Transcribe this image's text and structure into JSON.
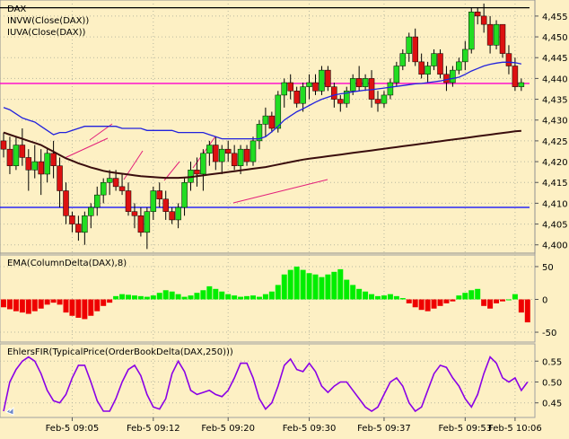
{
  "chart_data": [
    {
      "type": "candlestick",
      "labels": [
        "DAX",
        "INVW(Close(DAX))",
        "IUVA(Close(DAX))"
      ],
      "ylim": [
        4398,
        4458
      ],
      "yticks": [
        "4,400",
        "4,405",
        "4,410",
        "4,415",
        "4,420",
        "4,425",
        "4,430",
        "4,435",
        "4,440",
        "4,445",
        "4,450",
        "4,455"
      ],
      "xticks": [
        "Feb-5 09:05",
        "Feb-5 09:12",
        "Feb-5 09:20",
        "Feb-5 09:30",
        "Feb-5 09:37",
        "Feb-5 09:53",
        "Feb-5 10:06"
      ],
      "reference_lines": [
        {
          "value": 4457,
          "color": "#000000"
        },
        {
          "value": 4438.8,
          "color": "#ff00cc"
        },
        {
          "value": 4409,
          "color": "#0000ff"
        }
      ],
      "candles": [
        [
          4425,
          4427,
          4421,
          4423
        ],
        [
          4423,
          4426,
          4417,
          4419
        ],
        [
          4419,
          4426,
          4418,
          4424
        ],
        [
          4424,
          4428,
          4419,
          4421
        ],
        [
          4421,
          4423,
          4413,
          4418
        ],
        [
          4418,
          4424,
          4416,
          4420
        ],
        [
          4420,
          4423,
          4412,
          4417
        ],
        [
          4417,
          4423,
          4415,
          4422
        ],
        [
          4422,
          4425,
          4416,
          4419
        ],
        [
          4419,
          4421,
          4409,
          4413
        ],
        [
          4413,
          4415,
          4405,
          4407
        ],
        [
          4407,
          4408,
          4403,
          4405
        ],
        [
          4405,
          4407,
          4401,
          4403
        ],
        [
          4403,
          4408,
          4400,
          4407
        ],
        [
          4407,
          4410,
          4404,
          4409
        ],
        [
          4409,
          4414,
          4407,
          4412
        ],
        [
          4412,
          4416,
          4410,
          4415
        ],
        [
          4415,
          4418,
          4412,
          4416
        ],
        [
          4416,
          4418,
          4413,
          4414
        ],
        [
          4414,
          4417,
          4412,
          4413
        ],
        [
          4413,
          4415,
          4407,
          4408
        ],
        [
          4408,
          4410,
          4404,
          4407
        ],
        [
          4407,
          4409,
          4402,
          4403
        ],
        [
          4403,
          4409,
          4399,
          4408
        ],
        [
          4408,
          4414,
          4406,
          4413
        ],
        [
          4413,
          4415,
          4409,
          4411
        ],
        [
          4411,
          4413,
          4406,
          4408
        ],
        [
          4408,
          4409,
          4405,
          4406
        ],
        [
          4406,
          4410,
          4404,
          4409
        ],
        [
          4409,
          4416,
          4407,
          4415
        ],
        [
          4415,
          4420,
          4413,
          4418
        ],
        [
          4418,
          4421,
          4414,
          4417
        ],
        [
          4417,
          4423,
          4413,
          4422
        ],
        [
          4422,
          4425,
          4419,
          4424
        ],
        [
          4424,
          4426,
          4418,
          4420
        ],
        [
          4420,
          4424,
          4417,
          4423
        ],
        [
          4423,
          4425,
          4420,
          4422
        ],
        [
          4422,
          4424,
          4418,
          4419
        ],
        [
          4419,
          4424,
          4417,
          4423
        ],
        [
          4423,
          4424,
          4419,
          4420
        ],
        [
          4420,
          4426,
          4419,
          4425
        ],
        [
          4425,
          4430,
          4423,
          4429
        ],
        [
          4429,
          4433,
          4426,
          4431
        ],
        [
          4431,
          4432,
          4427,
          4428
        ],
        [
          4428,
          4437,
          4427,
          4436
        ],
        [
          4436,
          4440,
          4433,
          4439
        ],
        [
          4439,
          4441,
          4435,
          4437
        ],
        [
          4437,
          4438,
          4433,
          4434
        ],
        [
          4434,
          4439,
          4432,
          4438
        ],
        [
          4438,
          4441,
          4435,
          4439
        ],
        [
          4439,
          4441,
          4436,
          4437
        ],
        [
          4437,
          4443,
          4436,
          4442
        ],
        [
          4442,
          4443,
          4437,
          4438
        ],
        [
          4438,
          4439,
          4433,
          4435
        ],
        [
          4435,
          4436,
          4432,
          4434
        ],
        [
          4434,
          4438,
          4433,
          4437
        ],
        [
          4437,
          4441,
          4436,
          4440
        ],
        [
          4440,
          4443,
          4437,
          4438
        ],
        [
          4438,
          4441,
          4437,
          4440
        ],
        [
          4440,
          4442,
          4433,
          4435
        ],
        [
          4435,
          4437,
          4432,
          4434
        ],
        [
          4434,
          4437,
          4433,
          4436
        ],
        [
          4436,
          4440,
          4435,
          4439
        ],
        [
          4439,
          4444,
          4438,
          4443
        ],
        [
          4443,
          4447,
          4442,
          4446
        ],
        [
          4446,
          4451,
          4444,
          4450
        ],
        [
          4450,
          4452,
          4443,
          4444
        ],
        [
          4444,
          4446,
          4440,
          4441
        ],
        [
          4441,
          4444,
          4439,
          4443
        ],
        [
          4443,
          4447,
          4442,
          4446
        ],
        [
          4446,
          4447,
          4440,
          4441
        ],
        [
          4441,
          4443,
          4437,
          4439
        ],
        [
          4439,
          4443,
          4438,
          4442
        ],
        [
          4442,
          4445,
          4441,
          4444
        ],
        [
          4444,
          4449,
          4442,
          4447
        ],
        [
          4447,
          4457,
          4446,
          4456
        ],
        [
          4456,
          4457,
          4453,
          4455
        ],
        [
          4455,
          4458,
          4451,
          4453
        ],
        [
          4453,
          4455,
          4446,
          4448
        ],
        [
          4448,
          4454,
          4447,
          4453
        ],
        [
          4453,
          4453,
          4445,
          4446
        ],
        [
          4446,
          4448,
          4441,
          4443
        ],
        [
          4443,
          4445,
          4437,
          4438
        ],
        [
          4438,
          4440,
          4437,
          4439
        ]
      ],
      "invw": [
        4433,
        4432.5,
        4431.5,
        4430.5,
        4430,
        4429.5,
        4428.5,
        4427.5,
        4426.5,
        4427,
        4427,
        4427.5,
        4428,
        4428.5,
        4428.5,
        4428.5,
        4428.5,
        4428.5,
        4428.5,
        4428,
        4428,
        4428,
        4428,
        4427.5,
        4427.5,
        4427.5,
        4427.5,
        4427.5,
        4427,
        4427,
        4427,
        4427,
        4427,
        4426.5,
        4426,
        4425.5,
        4425.5,
        4425.5,
        4425.5,
        4425.5,
        4425.5,
        4425.5,
        4426,
        4427.2,
        4428.5,
        4430,
        4431,
        4432,
        4432.7,
        4433.5,
        4434.3,
        4435,
        4435.5,
        4436,
        4436.3,
        4436.5,
        4436.8,
        4437,
        4437.2,
        4437.3,
        4437.5,
        4437.7,
        4437.9,
        4438.1,
        4438.3,
        4438.5,
        4438.7,
        4438.8,
        4439,
        4439.2,
        4439.4,
        4439.7,
        4440,
        4440.3,
        4441,
        4441.8,
        4442.4,
        4443,
        4443.4,
        4443.7,
        4443.9,
        4443.9,
        4443.8,
        4443.5
      ],
      "iuva": [
        4427,
        4426.5,
        4426,
        4425.5,
        4425,
        4424.5,
        4424,
        4423.2,
        4422.4,
        4421.6,
        4420.8,
        4420.2,
        4419.6,
        4419.1,
        4418.6,
        4418.2,
        4417.8,
        4417.5,
        4417.3,
        4417.1,
        4416.9,
        4416.7,
        4416.5,
        4416.4,
        4416.3,
        4416.2,
        4416.1,
        4416.1,
        4416.1,
        4416.2,
        4416.3,
        4416.5,
        4416.7,
        4416.9,
        4417.1,
        4417.3,
        4417.5,
        4417.7,
        4417.9,
        4418.1,
        4418.3,
        4418.5,
        4418.7,
        4419,
        4419.3,
        4419.6,
        4419.9,
        4420.2,
        4420.5,
        4420.7,
        4420.9,
        4421.1,
        4421.3,
        4421.5,
        4421.7,
        4421.9,
        4422.1,
        4422.3,
        4422.5,
        4422.7,
        4422.9,
        4423.1,
        4423.3,
        4423.5,
        4423.7,
        4423.9,
        4424.1,
        4424.3,
        4424.5,
        4424.7,
        4424.9,
        4425.1,
        4425.3,
        4425.5,
        4425.7,
        4425.9,
        4426.1,
        4426.3,
        4426.5,
        4426.7,
        4426.9,
        4427.1,
        4427.3,
        4427.4
      ]
    },
    {
      "type": "bar",
      "label": "EMA(ColumnDelta(DAX),8)",
      "ylim": [
        -65,
        65
      ],
      "yticks": [
        "50",
        "0",
        "-50"
      ],
      "values": [
        -12,
        -15,
        -18,
        -20,
        -22,
        -18,
        -14,
        -8,
        -5,
        -8,
        -20,
        -25,
        -28,
        -30,
        -25,
        -18,
        -10,
        -5,
        5,
        8,
        7,
        6,
        5,
        4,
        6,
        10,
        14,
        12,
        8,
        4,
        6,
        10,
        14,
        20,
        16,
        12,
        8,
        6,
        4,
        5,
        6,
        4,
        8,
        12,
        22,
        38,
        45,
        50,
        45,
        40,
        38,
        34,
        38,
        42,
        46,
        30,
        22,
        16,
        12,
        8,
        5,
        6,
        8,
        5,
        2,
        -6,
        -12,
        -16,
        -18,
        -14,
        -10,
        -6,
        -3,
        6,
        10,
        14,
        16,
        -10,
        -14,
        -6,
        -3,
        0,
        8,
        -20,
        -35
      ]
    },
    {
      "type": "line",
      "label": "EhlersFIR(TypicalPrice(OrderBookDelta(DAX,250)))",
      "ylim": [
        0.415,
        0.585
      ],
      "yticks": [
        "0.55",
        "0.50",
        "0.45"
      ],
      "values": [
        0.43,
        0.5,
        0.53,
        0.55,
        0.56,
        0.55,
        0.52,
        0.48,
        0.455,
        0.45,
        0.47,
        0.51,
        0.54,
        0.54,
        0.5,
        0.455,
        0.43,
        0.43,
        0.46,
        0.5,
        0.53,
        0.54,
        0.515,
        0.47,
        0.44,
        0.435,
        0.46,
        0.52,
        0.55,
        0.525,
        0.48,
        0.47,
        0.475,
        0.48,
        0.47,
        0.465,
        0.48,
        0.51,
        0.545,
        0.545,
        0.51,
        0.46,
        0.435,
        0.45,
        0.49,
        0.54,
        0.555,
        0.53,
        0.525,
        0.545,
        0.525,
        0.49,
        0.475,
        0.49,
        0.5,
        0.5,
        0.48,
        0.46,
        0.44,
        0.43,
        0.44,
        0.47,
        0.5,
        0.51,
        0.49,
        0.45,
        0.43,
        0.44,
        0.48,
        0.52,
        0.54,
        0.535,
        0.51,
        0.49,
        0.46,
        0.44,
        0.47,
        0.52,
        0.56,
        0.545,
        0.51,
        0.5,
        0.51,
        0.48,
        0.5
      ]
    }
  ]
}
